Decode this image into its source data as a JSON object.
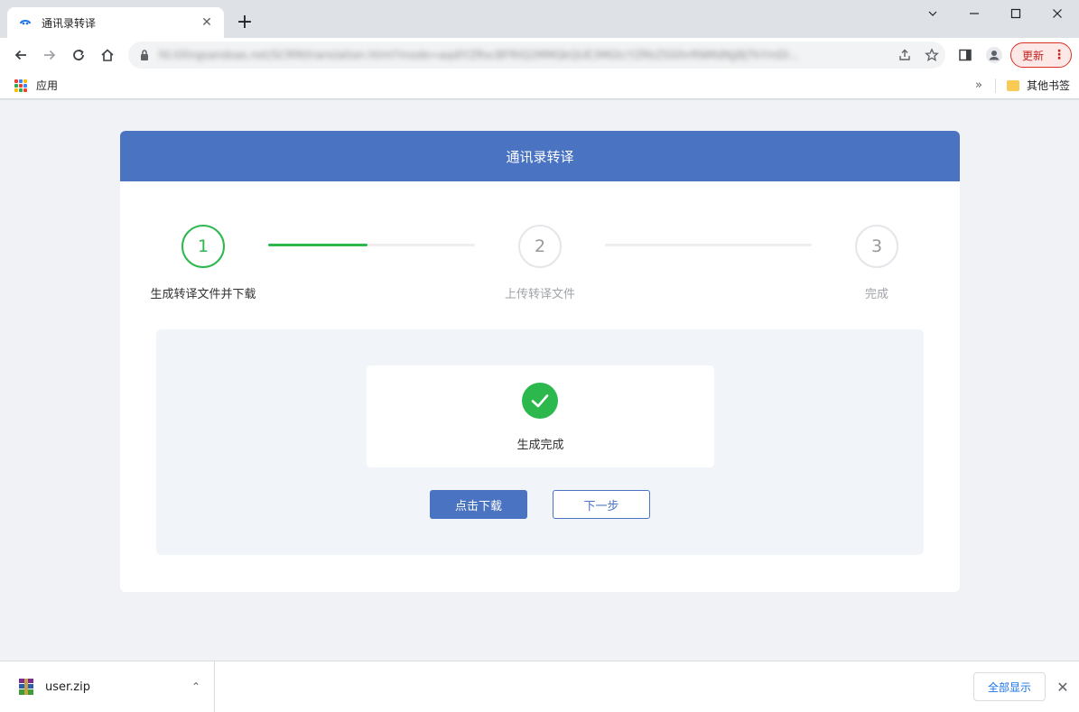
{
  "browser": {
    "tab_title": "通讯录转译",
    "tab_close": "✕",
    "new_tab": "+",
    "url": "fd.tillingsandsas.net/SCRM/translation.html?mode=aqdIYZRxcBFRIQ2MMQkQUE3MGtcYZRkZSSIhrRNMdNjJ8jTkYmDI...",
    "update_label": "更新",
    "update_more": "⋮",
    "window": {
      "minimize": "⌄",
      "restore": "—",
      "maximize": "☐",
      "close": "✕"
    }
  },
  "bookmarks": {
    "apps_label": "应用",
    "overflow": "»",
    "other_label": "其他书签"
  },
  "app": {
    "header_title": "通讯录转译",
    "steps": [
      {
        "number": "1",
        "label": "生成转译文件并下载",
        "status": "active"
      },
      {
        "number": "2",
        "label": "上传转译文件",
        "status": "pending"
      },
      {
        "number": "3",
        "label": "完成",
        "status": "pending"
      }
    ],
    "progress": [
      0.48,
      0
    ],
    "result_text": "生成完成",
    "download_button": "点击下载",
    "next_button": "下一步"
  },
  "downloads": {
    "file_name": "user.zip",
    "caret": "⌃",
    "show_all": "全部显示",
    "close": "✕"
  },
  "colors": {
    "primary": "#4a73c2",
    "success": "#2db84d"
  }
}
